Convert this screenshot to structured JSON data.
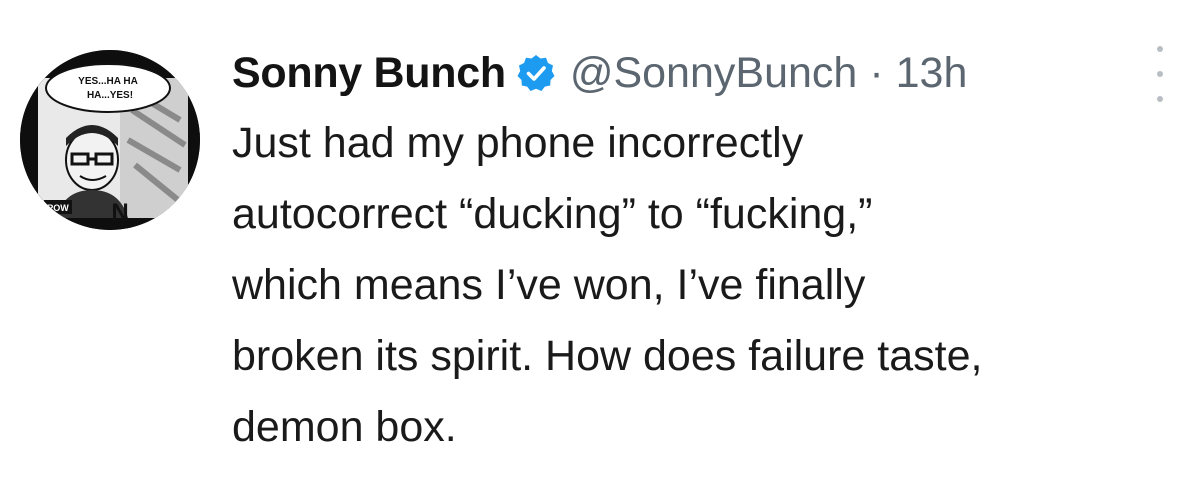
{
  "tweet": {
    "display_name": "Sonny Bunch",
    "handle": "@SonnyBunch",
    "separator": "·",
    "timestamp": "13h",
    "verified_color": "#1d9bf0",
    "body_lines": [
      "Just had my phone incorrectly",
      "autocorrect “ducking” to “fucking,”",
      "which means I’ve won, I’ve finally",
      "broken its spirit. How does failure taste,",
      "demon box."
    ],
    "avatar": {
      "comic_bubble_text_top": "YES...HA HA",
      "comic_bubble_text_bottom": "HA...YES!",
      "comic_panel_text": "POW",
      "comic_letter": "N"
    }
  }
}
